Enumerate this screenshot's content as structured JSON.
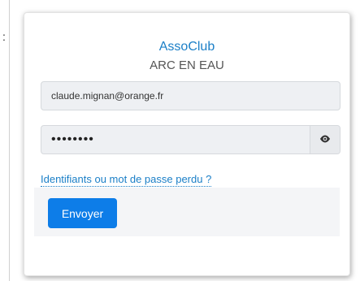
{
  "header": {
    "app_name": "AssoClub",
    "club_name": "ARC EN EAU"
  },
  "form": {
    "email_value": "claude.mignan@orange.fr",
    "password_masked": "••••••••",
    "show_password_icon": "eye-icon",
    "forgot_link": "Identifiants ou mot de passe perdu ?",
    "submit_label": "Envoyer"
  },
  "page": {
    "stray_colon": ":"
  },
  "colors": {
    "accent": "#1b7fc7",
    "button": "#0d7de8"
  }
}
